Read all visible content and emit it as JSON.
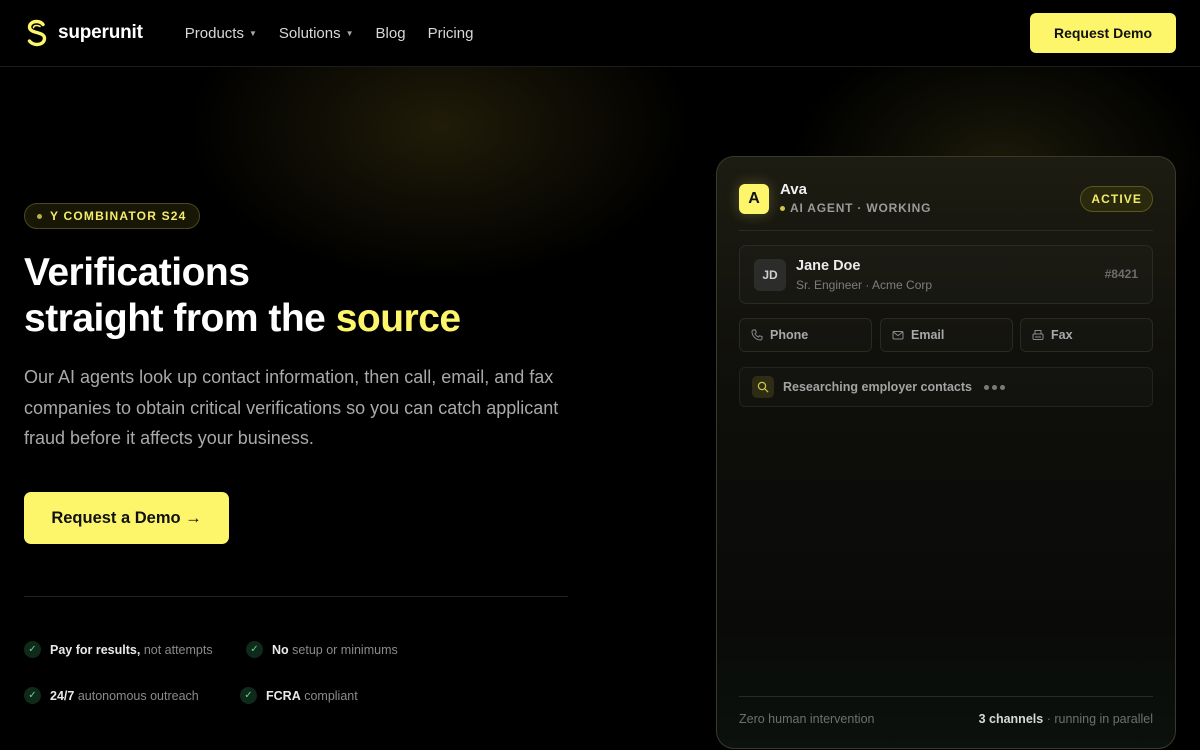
{
  "nav": {
    "brand": "superunit",
    "menu": [
      {
        "label": "Products",
        "has_dropdown": true
      },
      {
        "label": "Solutions",
        "has_dropdown": true
      },
      {
        "label": "Blog",
        "has_dropdown": false
      },
      {
        "label": "Pricing",
        "has_dropdown": false
      }
    ],
    "cta": "Request Demo"
  },
  "hero": {
    "badge": "Y COMBINATOR S24",
    "headline_line1": "Verifications",
    "headline_line2": "straight from the",
    "headline_accent": "source",
    "subtext": "Our AI agents look up contact information, then call, email, and fax companies to obtain critical verifications so you can catch applicant fraud before it affects your business.",
    "cta": "Request a Demo →",
    "features": [
      {
        "bold": "Pay for results,",
        "rest": "not attempts"
      },
      {
        "bold": "No",
        "rest": "setup or minimums"
      },
      {
        "bold": "24/7",
        "rest": "autonomous outreach"
      },
      {
        "bold": "FCRA",
        "rest": "compliant"
      }
    ]
  },
  "card": {
    "agent_initial": "A",
    "agent_name": "Ava",
    "agent_status": "AI AGENT · WORKING",
    "status_badge": "ACTIVE",
    "contact": {
      "initials": "JD",
      "name": "Jane Doe",
      "role": "Sr. Engineer · Acme Corp",
      "id": "#8421"
    },
    "channels": [
      {
        "label": "Phone",
        "icon": "phone-icon"
      },
      {
        "label": "Email",
        "icon": "mail-icon"
      },
      {
        "label": "Fax",
        "icon": "fax-icon"
      }
    ],
    "task": "Researching employer contacts",
    "footer_left": "Zero human intervention",
    "footer_right_bold": "3 channels",
    "footer_right_rest": "· running in parallel"
  },
  "colors": {
    "accent": "#fdf66b",
    "background": "#000000",
    "check_green": "#5fd68a"
  }
}
